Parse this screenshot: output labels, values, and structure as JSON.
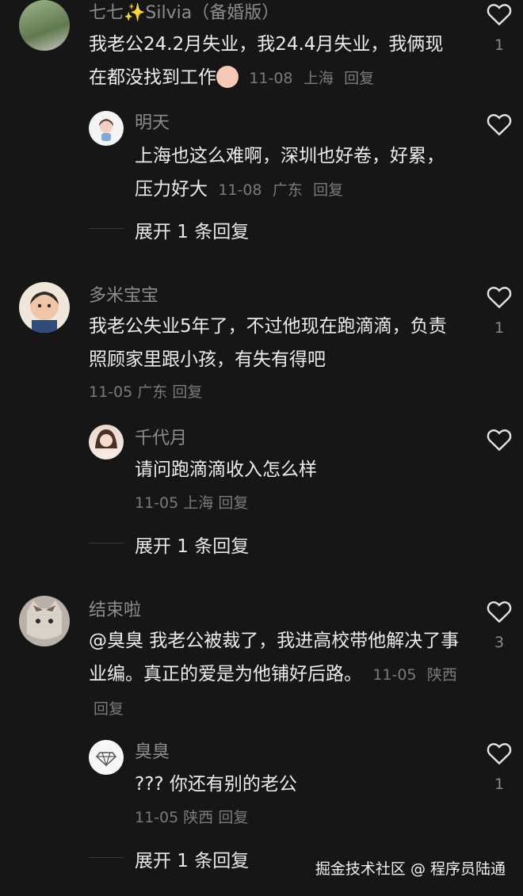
{
  "comments": [
    {
      "username": "七七✨Silvia（备婚版）",
      "text": "我老公24.2月失业，我24.4月失业，我俩现在都没找到工作",
      "date": "11-08",
      "location": "上海",
      "reply_label": "回复",
      "likes": "1",
      "replies": [
        {
          "username": "明天",
          "text": "上海也这么难啊，深圳也好卷，好累，压力好大",
          "date": "11-08",
          "location": "广东",
          "reply_label": "回复",
          "likes": ""
        }
      ],
      "expand_label": "展开 1 条回复"
    },
    {
      "username": "多米宝宝",
      "text": "我老公失业5年了，不过他现在跑滴滴，负责照顾家里跟小孩，有失有得吧",
      "date": "11-05",
      "location": "广东",
      "reply_label": "回复",
      "likes": "1",
      "replies": [
        {
          "username": "千代月",
          "text": "请问跑滴滴收入怎么样",
          "date": "11-05",
          "location": "上海",
          "reply_label": "回复",
          "likes": ""
        }
      ],
      "expand_label": "展开 1 条回复"
    },
    {
      "username": "结束啦",
      "text": "@臭臭 我老公被裁了，我进高校带他解决了事业编。真正的爱是为他铺好后路。",
      "date": "11-05",
      "location": "陕西",
      "reply_label": "回复",
      "likes": "3",
      "replies": [
        {
          "username": "臭臭",
          "text": "??? 你还有别的老公",
          "date": "11-05",
          "location": "陕西",
          "reply_label": "回复",
          "likes": "1"
        }
      ],
      "expand_label": "展开 1 条回复"
    }
  ],
  "watermark": "掘金技术社区 @ 程序员陆通",
  "colors": {
    "background": "#161616",
    "text": "#ececec",
    "meta": "#7a7a7a"
  }
}
